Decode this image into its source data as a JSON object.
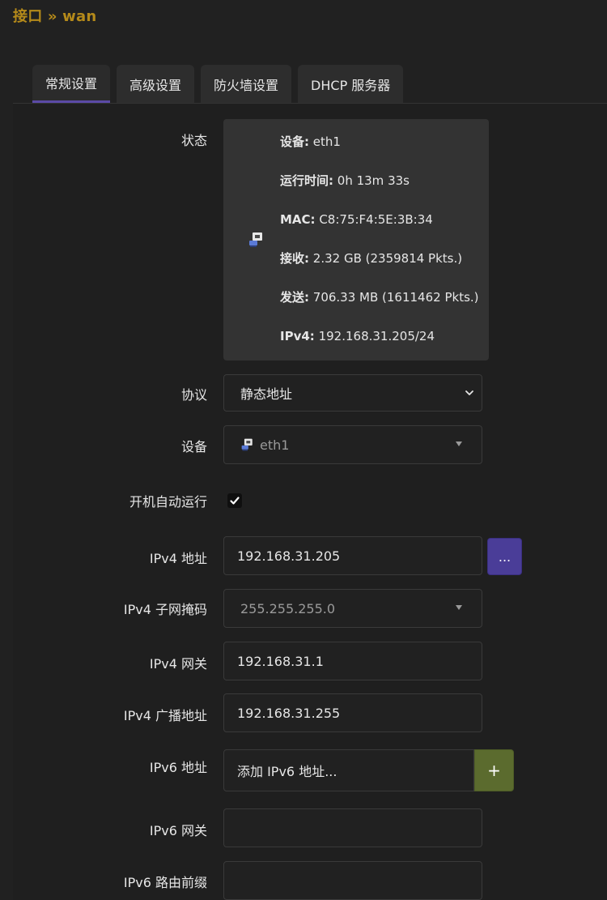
{
  "page": {
    "title": "接口 » wan"
  },
  "tabs": [
    {
      "label": "常规设置"
    },
    {
      "label": "高级设置"
    },
    {
      "label": "防火墙设置"
    },
    {
      "label": "DHCP 服务器"
    }
  ],
  "status": {
    "label": "状态",
    "device_key": "设备:",
    "device_val": "eth1",
    "uptime_key": "运行时间:",
    "uptime_val": "0h 13m 33s",
    "mac_key": "MAC:",
    "mac_val": "C8:75:F4:5E:3B:34",
    "rx_key": "接收:",
    "rx_val": "2.32 GB (2359814 Pkts.)",
    "tx_key": "发送:",
    "tx_val": "706.33 MB (1611462 Pkts.)",
    "ipv4_key": "IPv4:",
    "ipv4_val": "192.168.31.205/24"
  },
  "form": {
    "protocol_label": "协议",
    "protocol_value": "静态地址",
    "device_label": "设备",
    "device_value": "eth1",
    "autostart_label": "开机自动运行",
    "ipv4_addr_label": "IPv4 地址",
    "ipv4_addr_value": "192.168.31.205",
    "ipv4_addr_btn": "...",
    "ipv4_mask_label": "IPv4 子网掩码",
    "ipv4_mask_value": "255.255.255.0",
    "ipv4_gw_label": "IPv4 网关",
    "ipv4_gw_value": "192.168.31.1",
    "ipv4_bcast_label": "IPv4 广播地址",
    "ipv4_bcast_value": "192.168.31.255",
    "ipv6_addr_label": "IPv6 地址",
    "ipv6_addr_placeholder": "添加 IPv6 地址...",
    "ipv6_addr_btn": "+",
    "ipv6_gw_label": "IPv6 网关",
    "ipv6_gw_value": "",
    "ipv6_prefix_label": "IPv6 路由前缀",
    "ipv6_prefix_value": ""
  },
  "colors": {
    "title": "#b58a1a",
    "accent_purple": "#4a3d98",
    "accent_green": "#5b6b2e",
    "background": "#212121",
    "card": "#333333"
  },
  "icons": {
    "network_device": "ethernet-port-icon",
    "checkbox": "checkmark-icon",
    "select_chevron": "chevron-down-icon",
    "dropdown_caret": "triangle-down-icon"
  }
}
